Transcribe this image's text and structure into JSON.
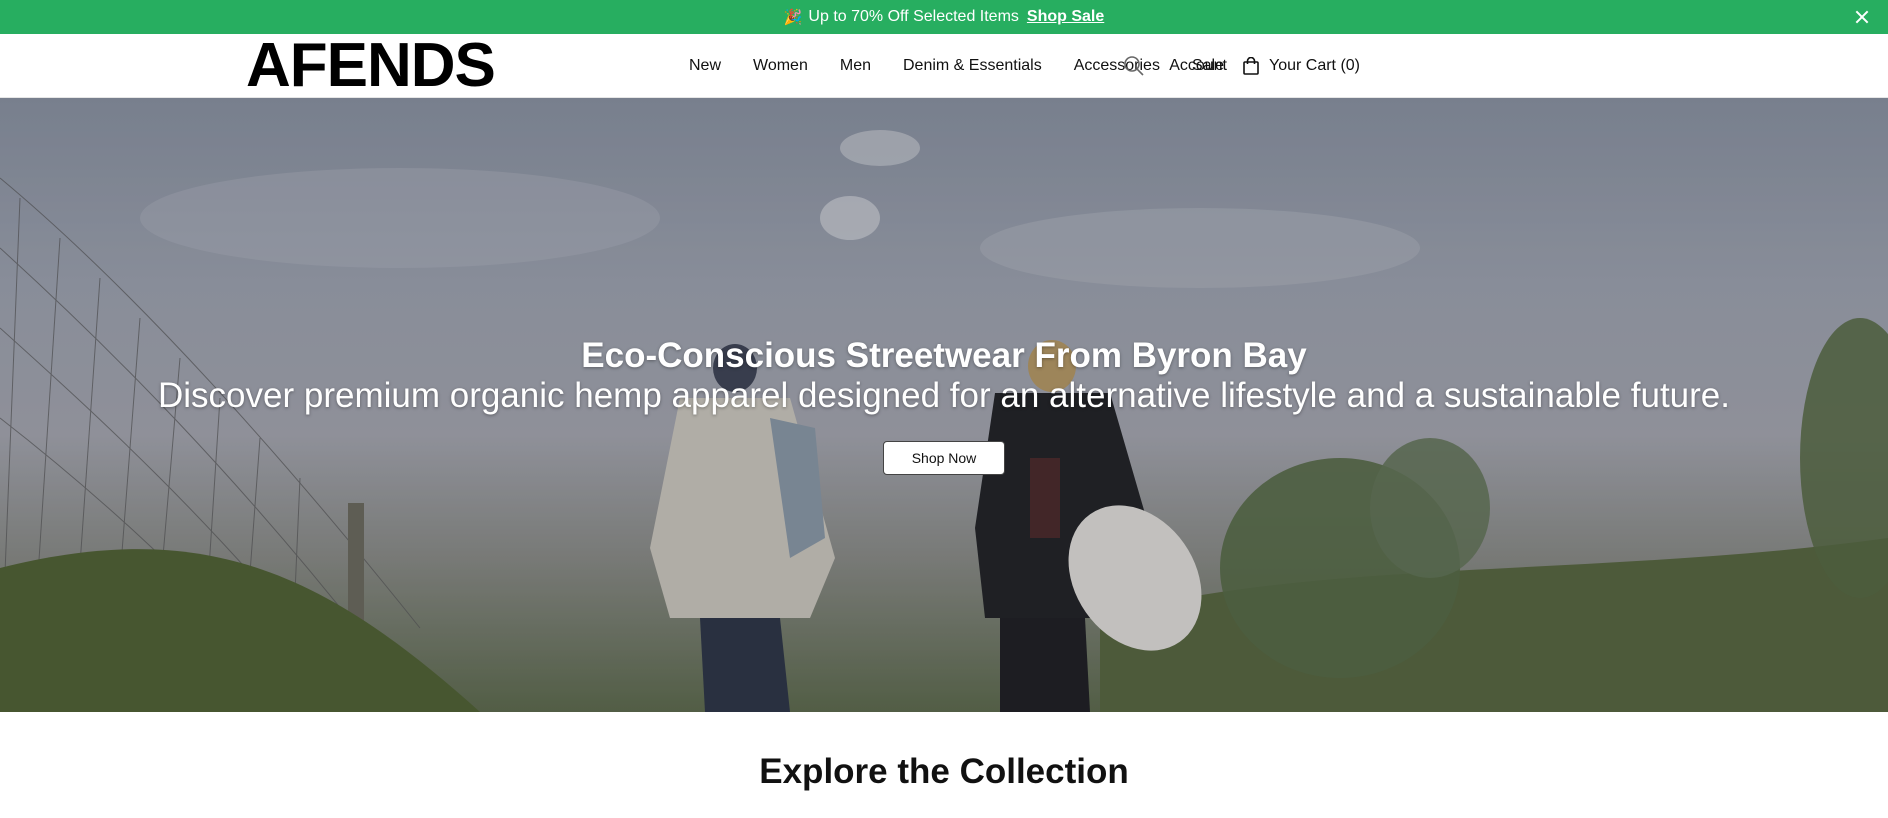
{
  "announcement": {
    "emoji": "🎉",
    "message": "Up to 70% Off Selected Items",
    "link_label": "Shop Sale",
    "bg_color": "#27ae60"
  },
  "header": {
    "logo": "AFENDS",
    "nav": [
      "New",
      "Women",
      "Men",
      "Denim & Essentials",
      "Accessories",
      "Sale"
    ],
    "search_icon": "search-icon",
    "account_label": "Account",
    "cart_label": "Your Cart (0)",
    "cart_icon": "shopping-bag-icon"
  },
  "hero": {
    "title": "Eco-Conscious Streetwear From Byron Bay",
    "subtitle": "Discover premium organic hemp apparel designed for an alternative lifestyle and a sustainable future.",
    "cta_label": "Shop Now"
  },
  "section": {
    "title": "Explore the Collection"
  }
}
